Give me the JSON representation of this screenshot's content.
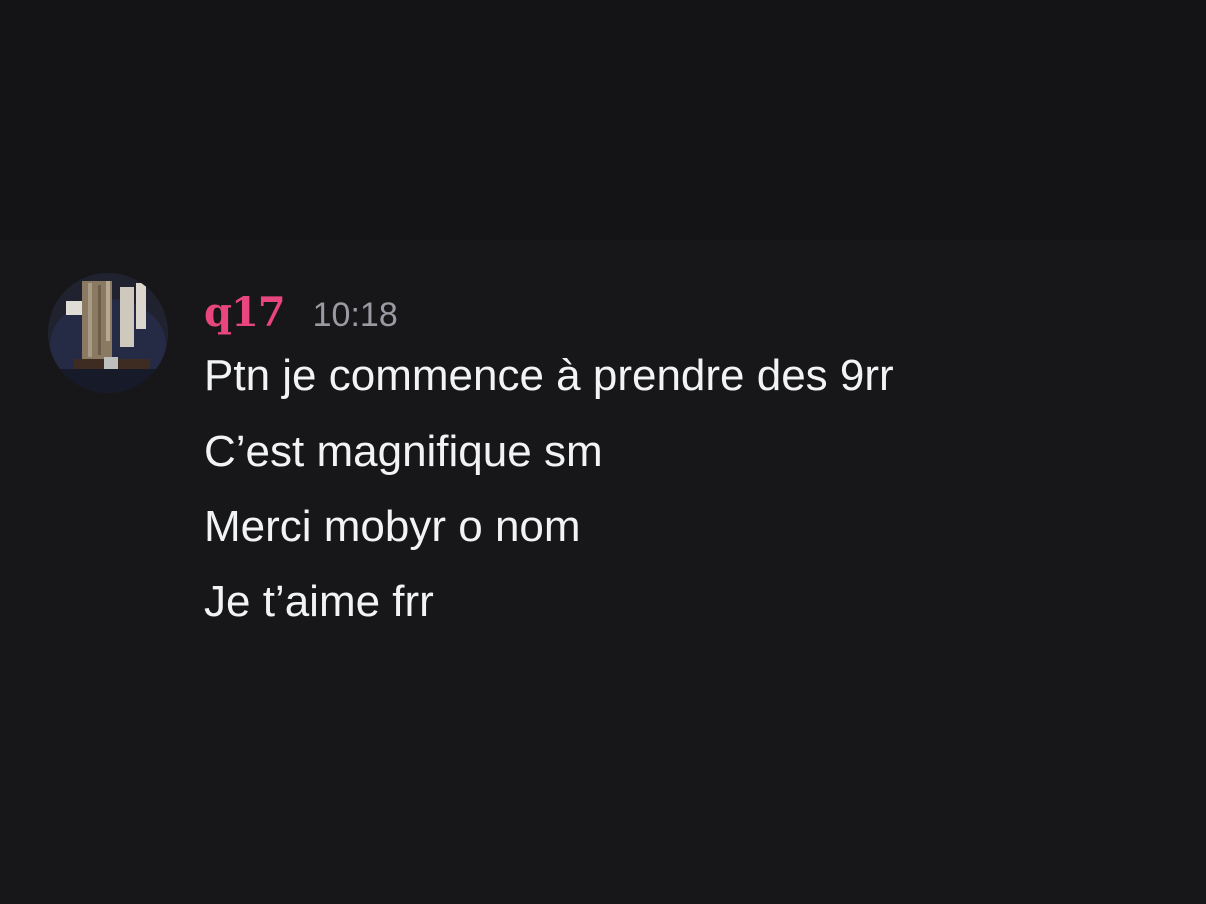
{
  "message": {
    "author": "q17",
    "timestamp": "10:18",
    "author_color": "#e8467c",
    "lines": [
      "Ptn je commence à prendre des 9rr",
      "C’est magnifique sm",
      "Merci mobyr o nom",
      "Je t’aime frr"
    ]
  },
  "colors": {
    "background": "#141416",
    "message_text": "#f2f3f5",
    "timestamp": "#9a9ba2"
  }
}
